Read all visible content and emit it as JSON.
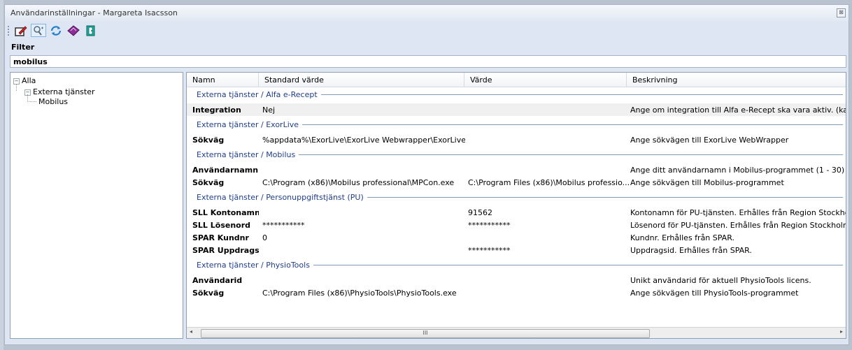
{
  "window": {
    "title": "Användarinställningar - Margareta Isacsson",
    "close": "⊠"
  },
  "toolbar": {
    "icons": [
      "edit-icon",
      "search-user-icon",
      "refresh-icon",
      "book-icon",
      "exit-door-icon"
    ]
  },
  "filter": {
    "label": "Filter",
    "value": "mobilus"
  },
  "tree": {
    "root": "Alla",
    "child": "Externa tjänster",
    "leaf": "Mobilus",
    "minus": "−"
  },
  "grid": {
    "columns": [
      "Namn",
      "Standard värde",
      "Värde",
      "Beskrivning"
    ],
    "groups": [
      {
        "title": "Externa tjänster / Alfa e-Recept",
        "rows": [
          [
            "Integration",
            "Nej",
            "",
            "Ange om integration till Alfa e-Recept ska vara aktiv. (kan b"
          ]
        ]
      },
      {
        "title": "Externa tjänster / ExorLive",
        "rows": [
          [
            "Sökväg",
            "%appdata%\\ExorLive\\ExorLive Webwrapper\\ExorLive...",
            "",
            "Ange sökvägen till ExorLive WebWrapper"
          ]
        ]
      },
      {
        "title": "Externa tjänster / Mobilus",
        "rows": [
          [
            "Användarnamn",
            "",
            "",
            "Ange ditt användarnamn i Mobilus-programmet (1 - 30)"
          ],
          [
            "Sökväg",
            "C:\\Program (x86)\\Mobilus professional\\MPCon.exe",
            "C:\\Program Files (x86)\\Mobilus professio...",
            "Ange sökvägen till Mobilus-programmet"
          ]
        ]
      },
      {
        "title": "Externa tjänster / Personuppgiftstjänst (PU)",
        "rows": [
          [
            "SLL Kontonamn",
            "",
            "91562",
            "Kontonamn för PU-tjänsten. Erhålles från Region Stockholm"
          ],
          [
            "SLL Lösenord",
            "***********",
            "***********",
            "Lösenord för PU-tjänsten. Erhålles från Region Stockholm."
          ],
          [
            "SPAR Kundnr",
            "0",
            "",
            "Kundnr. Erhålles från SPAR."
          ],
          [
            "SPAR Uppdragsid",
            "",
            "***********",
            "Uppdragsid. Erhålles från SPAR."
          ]
        ]
      },
      {
        "title": "Externa tjänster / PhysioTools",
        "rows": [
          [
            "Användarid",
            "",
            "",
            "Unikt användarid för aktuell PhysioTools licens."
          ],
          [
            "Sökväg",
            "C:\\Program Files (x86)\\PhysioTools\\PhysioTools.exe",
            "",
            "Ange sökvägen till PhysioTools-programmet"
          ]
        ]
      }
    ]
  },
  "scrollbar": {
    "left": "◂",
    "right": "▸",
    "grip": "III"
  },
  "colors": {
    "accent": "#1f3e8a",
    "border": "#8fa0b5",
    "window_bg": "#dde6f2"
  }
}
